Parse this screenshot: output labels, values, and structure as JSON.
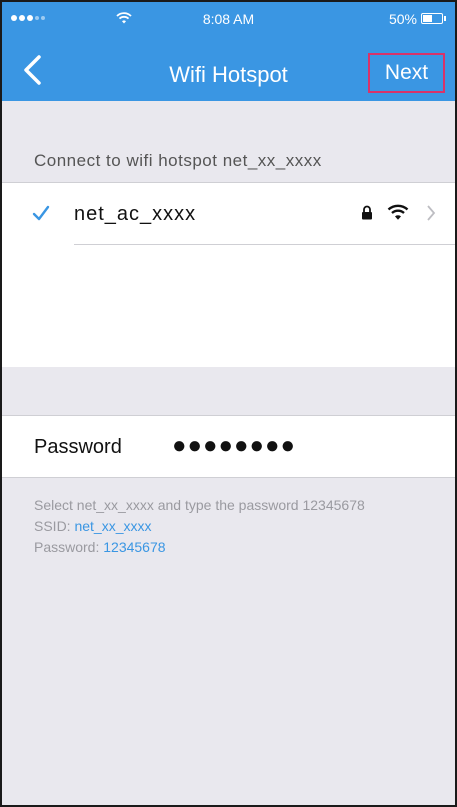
{
  "status_bar": {
    "time": "8:08 AM",
    "battery": "50%",
    "battery_level": 0.5
  },
  "nav": {
    "title": "Wifi Hotspot",
    "next_label": "Next"
  },
  "section": {
    "header": "Connect to wifi hotspot net_xx_xxxx"
  },
  "networks": [
    {
      "name": "net_ac_xxxx",
      "selected": true,
      "secured": true,
      "icons": [
        "checkmark-icon",
        "lock-icon",
        "wifi-icon",
        "chevron-right-icon"
      ]
    }
  ],
  "password": {
    "label": "Password",
    "value": "●●●●●●●●"
  },
  "help": {
    "line1": "Select net_xx_xxxx and type the password 12345678",
    "ssid_label": "SSID:",
    "ssid_value": "net_xx_xxxx",
    "password_label": "Password:",
    "password_value": "12345678"
  },
  "colors": {
    "accent": "#3a96e3",
    "highlight": "#d9336a",
    "background": "#e9e8ee"
  }
}
